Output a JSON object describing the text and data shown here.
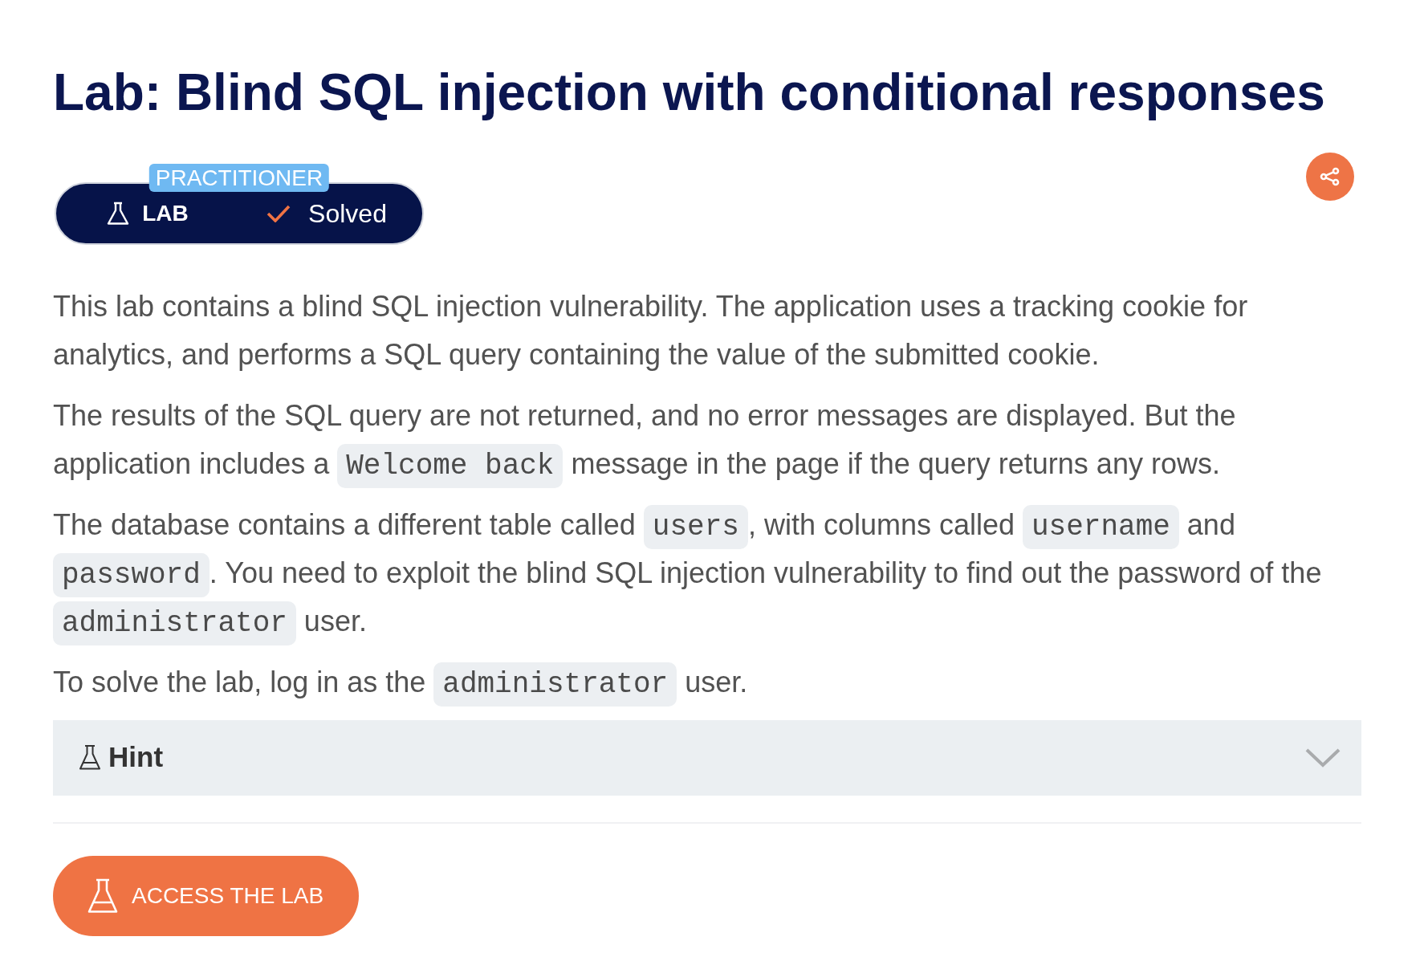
{
  "title": "Lab: Blind SQL injection with conditional responses",
  "lab_badge": {
    "level": "PRACTITIONER",
    "type": "LAB",
    "status": "Solved",
    "solved": true
  },
  "description": [
    {
      "parts": [
        {
          "kind": "text",
          "text": "This lab contains a blind SQL injection vulnerability. The application uses a tracking cookie for analytics, and performs a SQL query containing the value of the submitted cookie."
        }
      ]
    },
    {
      "parts": [
        {
          "kind": "text",
          "text": "The results of the SQL query are not returned, and no error messages are displayed. But the application includes a "
        },
        {
          "kind": "code",
          "text": "Welcome back"
        },
        {
          "kind": "text",
          "text": " message in the page if the query returns any rows."
        }
      ]
    },
    {
      "parts": [
        {
          "kind": "text",
          "text": "The database contains a different table called "
        },
        {
          "kind": "code",
          "text": "users"
        },
        {
          "kind": "text",
          "text": ", with columns called "
        },
        {
          "kind": "code",
          "text": "username"
        },
        {
          "kind": "text",
          "text": " and "
        },
        {
          "kind": "code",
          "text": "password"
        },
        {
          "kind": "text",
          "text": ". You need to exploit the blind SQL injection vulnerability to find out the password of the "
        },
        {
          "kind": "code",
          "text": "administrator"
        },
        {
          "kind": "text",
          "text": " user."
        }
      ]
    },
    {
      "parts": [
        {
          "kind": "text",
          "text": "To solve the lab, log in as the "
        },
        {
          "kind": "code",
          "text": "administrator"
        },
        {
          "kind": "text",
          "text": " user."
        }
      ]
    }
  ],
  "hint": {
    "label": "Hint",
    "expanded": false
  },
  "access_button": {
    "label": "ACCESS THE LAB"
  }
}
